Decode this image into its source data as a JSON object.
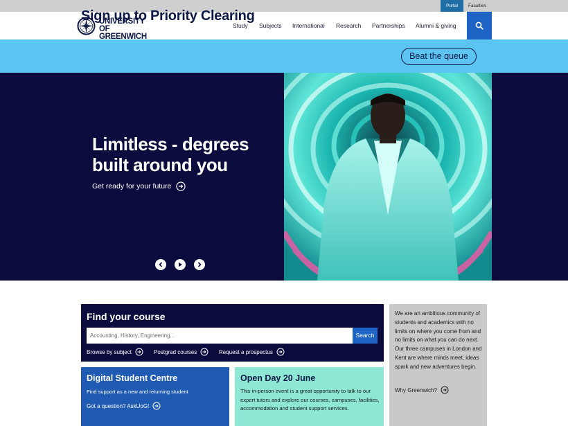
{
  "utility": {
    "portal": "Portal",
    "faculties": "Faculties"
  },
  "header": {
    "logo_line1": "UNIVERSITY OF",
    "logo_line2": "GREENWICH",
    "nav": [
      {
        "label": "Study"
      },
      {
        "label": "Subjects"
      },
      {
        "label": "International"
      },
      {
        "label": "Research"
      },
      {
        "label": "Partnerships"
      },
      {
        "label": "Alumni & giving"
      }
    ],
    "search_icon": "search-icon"
  },
  "clearing": {
    "title": "Sign up to Priority Clearing",
    "button": "Beat the queue"
  },
  "hero": {
    "title": "Limitless - degrees built around you",
    "link": "Get ready for your future",
    "controls": [
      "prev",
      "play",
      "next"
    ]
  },
  "find_course": {
    "title": "Find your course",
    "placeholder": "Accounting, History, Engineering...",
    "search_label": "Search",
    "links": [
      "Browse by subject",
      "Postgrad courses",
      "Request a prospectus"
    ]
  },
  "side_card": {
    "text": "We are an ambitious community of students and academics with no limits on where you come from and no limits on what you can do next. Our three campuses in London and Kent are where minds meet, ideas spark and new adventures begin.",
    "link": "Why Greenwich?"
  },
  "digital_centre": {
    "title": "Digital Student Centre",
    "subtitle": "Find support as a new and returning student",
    "link": "Got a question? AskUoG!"
  },
  "open_day": {
    "title": "Open Day 20 June",
    "text": "This in-person event is a great opportunity to talk to our expert tutors and explore our courses, campuses, facilities, accommodation and student support services."
  },
  "colors": {
    "navy": "#0c0b3e",
    "clearing_blue": "#5cc4f2",
    "accent_blue": "#1f63c4",
    "teal": "#8de7d3",
    "grey": "#c9c9c9"
  }
}
